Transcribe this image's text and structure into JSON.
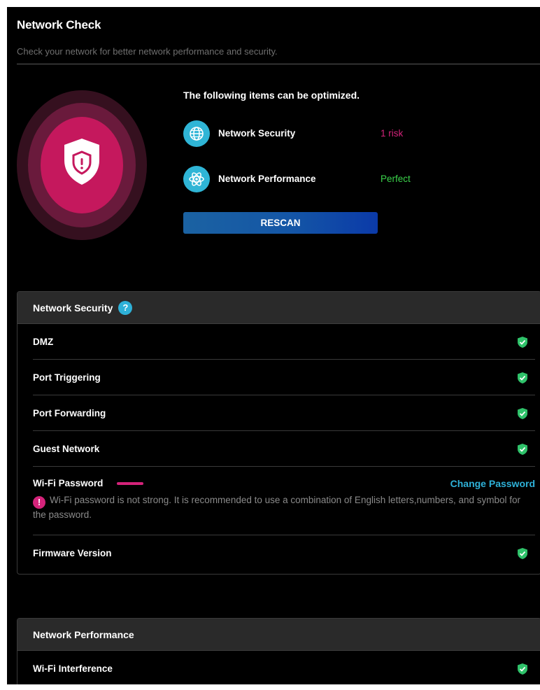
{
  "header": {
    "title": "Network Check",
    "subtitle": "Check your network for better network performance and security."
  },
  "summary": {
    "title": "The following items can be optimized.",
    "security_label": "Network Security",
    "security_status": "1 risk",
    "performance_label": "Network Performance",
    "performance_status": "Perfect",
    "rescan_label": "RESCAN"
  },
  "security_card": {
    "title": "Network Security",
    "help": "?",
    "items": [
      {
        "label": "DMZ",
        "status": "ok"
      },
      {
        "label": "Port Triggering",
        "status": "ok"
      },
      {
        "label": "Port Forwarding",
        "status": "ok"
      },
      {
        "label": "Guest Network",
        "status": "ok"
      },
      {
        "label": "Wi-Fi Password",
        "status": "risk"
      },
      {
        "label": "Firmware Version",
        "status": "ok"
      }
    ],
    "wifi_action": "Change Password",
    "wifi_warning": "Wi-Fi password is not strong. It is recommended to use a combination of English letters,numbers, and symbol for the password.",
    "warning_symbol": "!"
  },
  "performance_card": {
    "title": "Network Performance",
    "items": [
      {
        "label": "Wi-Fi Interference",
        "status": "ok"
      }
    ]
  },
  "icons": {
    "shield": "shield-alert-icon",
    "security": "globe-icon",
    "performance": "atom-icon",
    "ok": "shield-check-icon",
    "help": "help-icon",
    "warning": "warning-icon"
  },
  "colors": {
    "accent": "#2eb1d8",
    "risk": "#d4237a",
    "perfect": "#3bd34b",
    "rescan_start": "#1b62a2",
    "rescan_end": "#0b3aa8",
    "ok": "#2fc26a"
  }
}
